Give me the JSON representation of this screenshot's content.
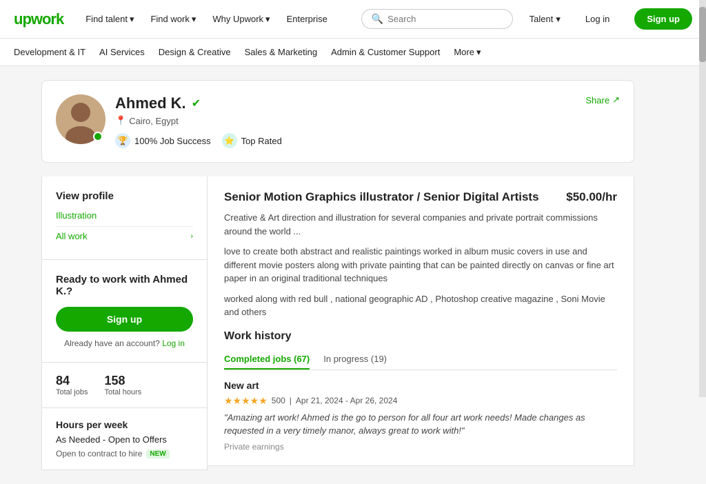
{
  "brand": {
    "logo": "upwork",
    "logo_color": "#14a800"
  },
  "top_nav": {
    "find_talent": "Find talent",
    "find_work": "Find work",
    "why_upwork": "Why Upwork",
    "enterprise": "Enterprise",
    "search_placeholder": "Search",
    "talent_label": "Talent",
    "login_label": "Log in",
    "signup_label": "Sign up"
  },
  "sub_nav": {
    "items": [
      "Development & IT",
      "AI Services",
      "Design & Creative",
      "Sales & Marketing",
      "Admin & Customer Support",
      "More"
    ]
  },
  "profile": {
    "name": "Ahmed K.",
    "verified": true,
    "location": "Cairo, Egypt",
    "job_success": "100% Job Success",
    "top_rated": "Top Rated",
    "share_label": "Share"
  },
  "left_col": {
    "view_profile_title": "View profile",
    "illustration_link": "Illustration",
    "all_work_label": "All work",
    "ready_title": "Ready to work with Ahmed K.?",
    "signup_btn": "Sign up",
    "already_account_text": "Already have an account?",
    "login_link": "Log in",
    "total_jobs_num": "84",
    "total_jobs_label": "Total jobs",
    "total_hours_num": "158",
    "total_hours_label": "Total hours",
    "hours_title": "Hours per week",
    "hours_value": "As Needed - Open to Offers",
    "contract_label": "Open to contract to hire",
    "new_badge": "NEW"
  },
  "right_col": {
    "job_title": "Senior Motion Graphics illustrator / Senior Digital Artists",
    "hourly_rate": "$50.00/hr",
    "desc_1": "Creative & Art direction and illustration for several companies and private portrait commissions around the world ...",
    "desc_2": "love to create both abstract and realistic paintings worked in album music covers in use and different movie posters along with private painting that can be painted directly on canvas or fine art paper in an original traditional techniques",
    "desc_3": "worked along with red bull , national geographic AD , Photoshop creative magazine , Soni Movie and others",
    "work_history_title": "Work history",
    "tab_completed": "Completed jobs (67)",
    "tab_inprogress": "In progress (19)",
    "job_entry_title": "New art",
    "stars": "★★★★★",
    "star_count": "500",
    "job_date": "Apr 21, 2024 - Apr 26, 2024",
    "job_review": "\"Amazing art work! Ahmed is the go to person for all four art work needs! Made changes as requested in a very timely manor, always great to work with!\"",
    "private_earnings": "Private earnings"
  }
}
